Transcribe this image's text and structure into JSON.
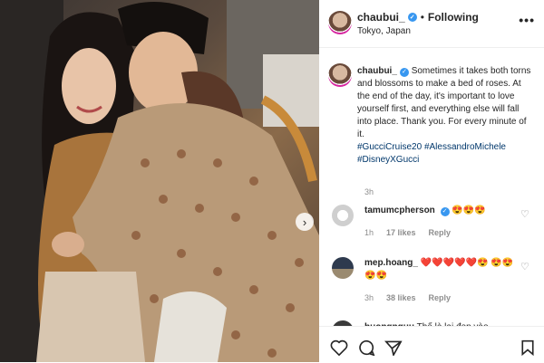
{
  "post": {
    "username": "chaubui_",
    "follow_label": "Following",
    "separator": "•",
    "location": "Tokyo, Japan",
    "more_label": "•••",
    "caption_user": "chaubui_",
    "caption_text": "Sometimes it takes both torns and blossoms to make a bed of roses. At the end of the day, it's important to love yourself first, and everything else will fall into place. Thank you. For every minute of it.",
    "hashtags": [
      "#GucciCruise20",
      "#AlessandroMichele",
      "#DisneyXGucci"
    ],
    "age": "3h",
    "next_arrow": "›"
  },
  "comments": [
    {
      "username": "tamumcpherson",
      "verified": true,
      "text": "😍😍😍",
      "age": "1h",
      "likes": "17 likes",
      "reply": "Reply"
    },
    {
      "username": "mep.hoang_",
      "verified": false,
      "text": "❤️❤️❤️❤️❤️😍 😍😍😍😍",
      "age": "3h",
      "likes": "38 likes",
      "reply": "Reply"
    },
    {
      "username": "huongnguu",
      "text": "Thế là lại đẹp vào..."
    }
  ],
  "colors": {
    "link": "#00376b",
    "verified": "#3897f0",
    "meta": "#8e8e8e"
  },
  "icons": [
    "heart-icon",
    "comment-icon",
    "share-icon",
    "bookmark-icon",
    "verified-badge-icon",
    "chevron-right-icon"
  ]
}
